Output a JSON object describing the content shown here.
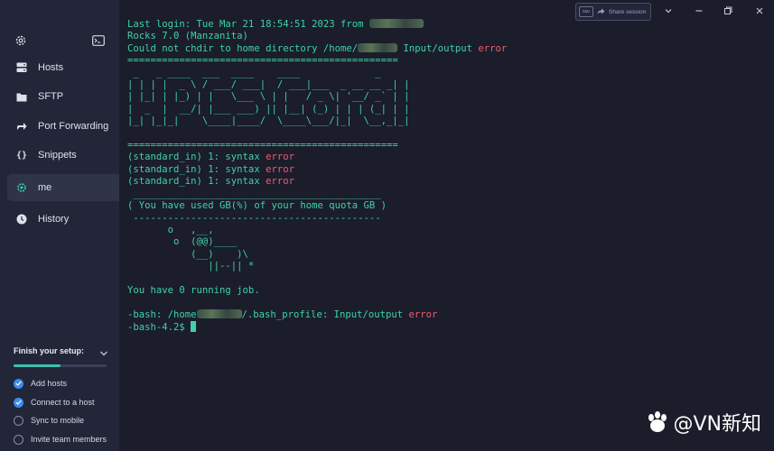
{
  "sidebar": {
    "top_icons": [
      "gear-icon",
      "terminal-icon"
    ],
    "items": [
      {
        "label": "Hosts",
        "icon": "hosts-icon"
      },
      {
        "label": "SFTP",
        "icon": "folder-icon"
      },
      {
        "label": "Port Forwarding",
        "icon": "forward-arrow-icon"
      },
      {
        "label": "Snippets",
        "icon": "braces-icon"
      },
      {
        "label": "me",
        "icon": "gear-icon",
        "active": true
      },
      {
        "label": "History",
        "icon": "clock-icon"
      }
    ],
    "setup": {
      "title": "Finish your setup:",
      "progress": 0.5,
      "steps": [
        {
          "label": "Add hosts",
          "done": true
        },
        {
          "label": "Connect to a host",
          "done": true
        },
        {
          "label": "Sync to mobile",
          "done": false
        },
        {
          "label": "Invite team members",
          "done": false
        }
      ]
    }
  },
  "titlebar": {
    "session_pill": "ssu",
    "share_label": "Share session"
  },
  "terminal": {
    "last_login": "Last login: Tue Mar 21 18:54:51 2023 from ",
    "rocks": "Rocks 7.0 (Manzanita)",
    "chdir_prefix": "Could not chdir to home directory /home/",
    "chdir_suffix": " Input/output ",
    "error_word": "error",
    "rule": "===============================================",
    "banner": [
      " _   _ ____  ___  ____    ____             _  ",
      "| | | |  _ \\ / ___/ ___|  / ___|___  _ __ __ _| |",
      "| |_| | |_) | |   \\___ \\ | |   / _ \\| '__/ _` | |",
      "|  _  |  __/| |___ ___) || |__| (_) | | | (_| | |",
      "|_| |_|_|    \\____|____/  \\____\\___/|_|  \\__,_|_|"
    ],
    "syntax_prefix": "(standard_in) 1: syntax ",
    "cow_top": " ___________________________________________",
    "cow_msg": "( You have used GB(%) of your home quota GB )",
    "cow_bottom": " -------------------------------------------",
    "cow": [
      "       o   ,__,",
      "        o  (@@)____",
      "           (__)    )\\",
      "              ||--|| *"
    ],
    "jobs": "You have 0 running job.",
    "bash_prefix": "-bash: /home",
    "bash_suffix": "/.bash_profile: Input/output ",
    "prompt": "-bash-4.2$ "
  },
  "watermark": "@VN新知",
  "colors": {
    "accent": "#3ed2a8",
    "error": "#ee5d6d",
    "check": "#3d8bef"
  }
}
